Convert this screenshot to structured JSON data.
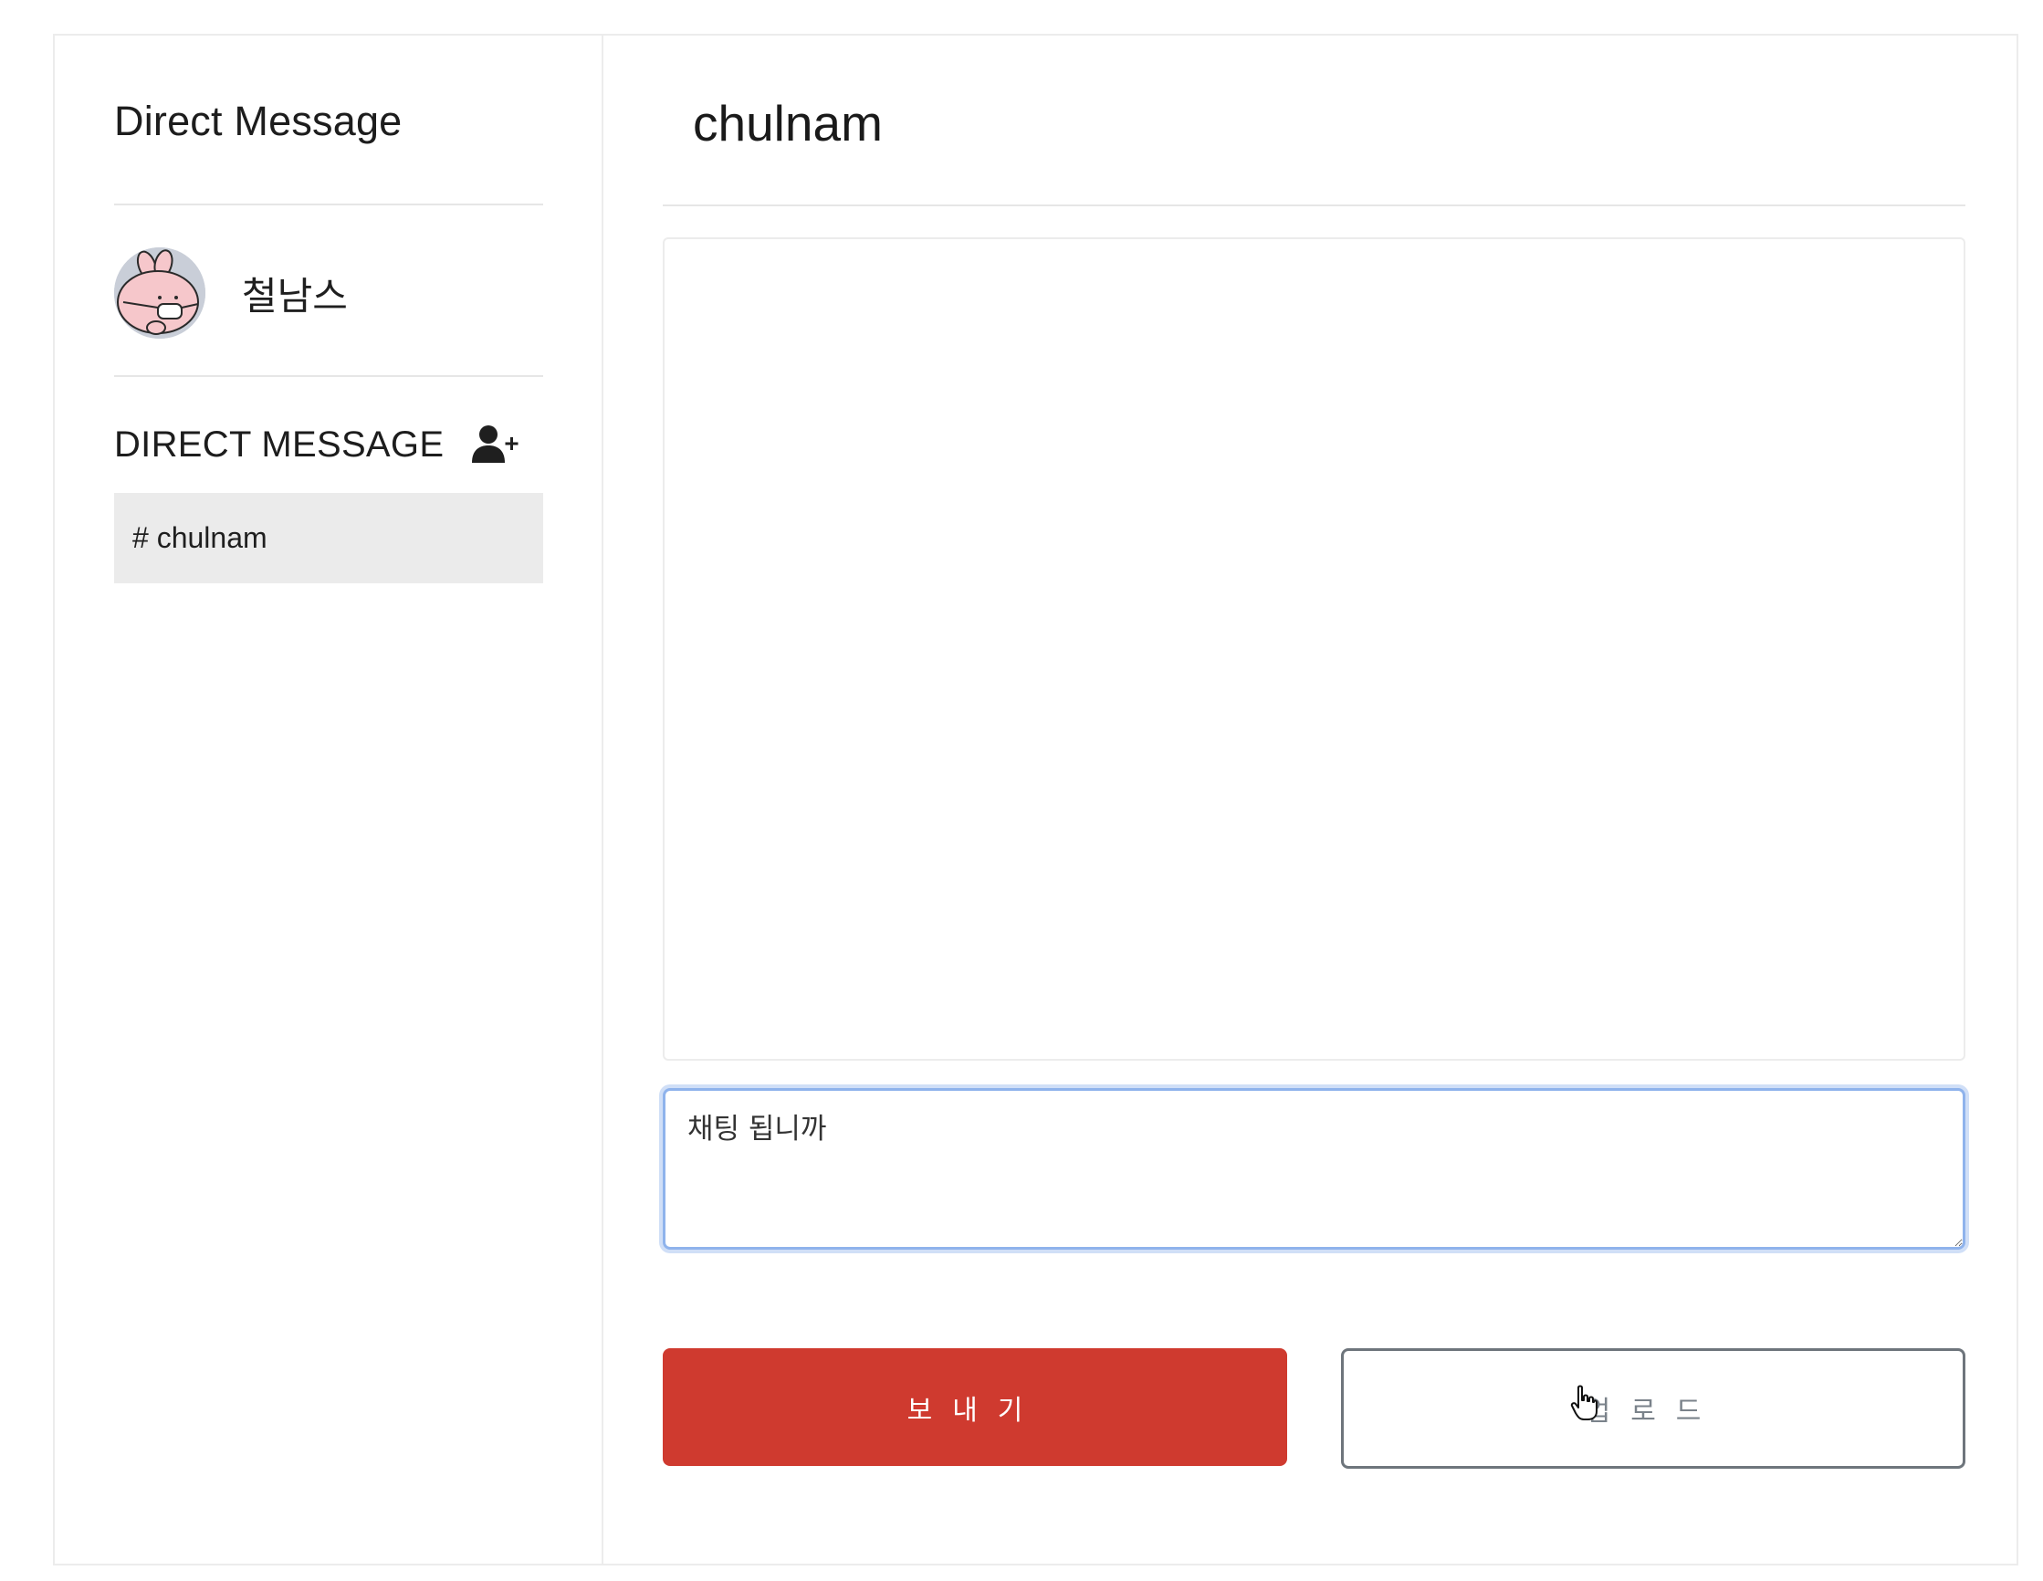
{
  "sidebar": {
    "title": "Direct Message",
    "profile": {
      "name": "철남스",
      "avatar_icon": "pink-bunny-avatar"
    },
    "section_title": "DIRECT MESSAGE",
    "add_icon": "add-user-icon",
    "dm_items": [
      {
        "label": "# chulnam",
        "active": true
      }
    ]
  },
  "main": {
    "title": "chulnam",
    "composer": {
      "value": "채팅 됩니까"
    },
    "send_label": "보내기",
    "upload_label": "업로드"
  },
  "colors": {
    "send_button": "#cf3a2f",
    "active_item_bg": "#ebebeb",
    "focus_ring": "#8fb3ec"
  }
}
